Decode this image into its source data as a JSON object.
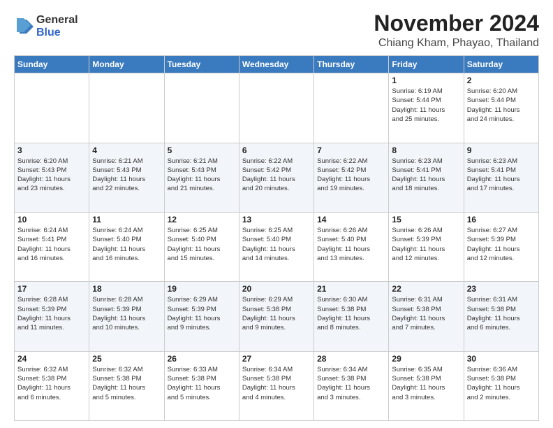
{
  "logo": {
    "general": "General",
    "blue": "Blue"
  },
  "title": "November 2024",
  "location": "Chiang Kham, Phayao, Thailand",
  "days_header": [
    "Sunday",
    "Monday",
    "Tuesday",
    "Wednesday",
    "Thursday",
    "Friday",
    "Saturday"
  ],
  "weeks": [
    [
      {
        "day": "",
        "info": ""
      },
      {
        "day": "",
        "info": ""
      },
      {
        "day": "",
        "info": ""
      },
      {
        "day": "",
        "info": ""
      },
      {
        "day": "",
        "info": ""
      },
      {
        "day": "1",
        "info": "Sunrise: 6:19 AM\nSunset: 5:44 PM\nDaylight: 11 hours\nand 25 minutes."
      },
      {
        "day": "2",
        "info": "Sunrise: 6:20 AM\nSunset: 5:44 PM\nDaylight: 11 hours\nand 24 minutes."
      }
    ],
    [
      {
        "day": "3",
        "info": "Sunrise: 6:20 AM\nSunset: 5:43 PM\nDaylight: 11 hours\nand 23 minutes."
      },
      {
        "day": "4",
        "info": "Sunrise: 6:21 AM\nSunset: 5:43 PM\nDaylight: 11 hours\nand 22 minutes."
      },
      {
        "day": "5",
        "info": "Sunrise: 6:21 AM\nSunset: 5:43 PM\nDaylight: 11 hours\nand 21 minutes."
      },
      {
        "day": "6",
        "info": "Sunrise: 6:22 AM\nSunset: 5:42 PM\nDaylight: 11 hours\nand 20 minutes."
      },
      {
        "day": "7",
        "info": "Sunrise: 6:22 AM\nSunset: 5:42 PM\nDaylight: 11 hours\nand 19 minutes."
      },
      {
        "day": "8",
        "info": "Sunrise: 6:23 AM\nSunset: 5:41 PM\nDaylight: 11 hours\nand 18 minutes."
      },
      {
        "day": "9",
        "info": "Sunrise: 6:23 AM\nSunset: 5:41 PM\nDaylight: 11 hours\nand 17 minutes."
      }
    ],
    [
      {
        "day": "10",
        "info": "Sunrise: 6:24 AM\nSunset: 5:41 PM\nDaylight: 11 hours\nand 16 minutes."
      },
      {
        "day": "11",
        "info": "Sunrise: 6:24 AM\nSunset: 5:40 PM\nDaylight: 11 hours\nand 16 minutes."
      },
      {
        "day": "12",
        "info": "Sunrise: 6:25 AM\nSunset: 5:40 PM\nDaylight: 11 hours\nand 15 minutes."
      },
      {
        "day": "13",
        "info": "Sunrise: 6:25 AM\nSunset: 5:40 PM\nDaylight: 11 hours\nand 14 minutes."
      },
      {
        "day": "14",
        "info": "Sunrise: 6:26 AM\nSunset: 5:40 PM\nDaylight: 11 hours\nand 13 minutes."
      },
      {
        "day": "15",
        "info": "Sunrise: 6:26 AM\nSunset: 5:39 PM\nDaylight: 11 hours\nand 12 minutes."
      },
      {
        "day": "16",
        "info": "Sunrise: 6:27 AM\nSunset: 5:39 PM\nDaylight: 11 hours\nand 12 minutes."
      }
    ],
    [
      {
        "day": "17",
        "info": "Sunrise: 6:28 AM\nSunset: 5:39 PM\nDaylight: 11 hours\nand 11 minutes."
      },
      {
        "day": "18",
        "info": "Sunrise: 6:28 AM\nSunset: 5:39 PM\nDaylight: 11 hours\nand 10 minutes."
      },
      {
        "day": "19",
        "info": "Sunrise: 6:29 AM\nSunset: 5:39 PM\nDaylight: 11 hours\nand 9 minutes."
      },
      {
        "day": "20",
        "info": "Sunrise: 6:29 AM\nSunset: 5:38 PM\nDaylight: 11 hours\nand 9 minutes."
      },
      {
        "day": "21",
        "info": "Sunrise: 6:30 AM\nSunset: 5:38 PM\nDaylight: 11 hours\nand 8 minutes."
      },
      {
        "day": "22",
        "info": "Sunrise: 6:31 AM\nSunset: 5:38 PM\nDaylight: 11 hours\nand 7 minutes."
      },
      {
        "day": "23",
        "info": "Sunrise: 6:31 AM\nSunset: 5:38 PM\nDaylight: 11 hours\nand 6 minutes."
      }
    ],
    [
      {
        "day": "24",
        "info": "Sunrise: 6:32 AM\nSunset: 5:38 PM\nDaylight: 11 hours\nand 6 minutes."
      },
      {
        "day": "25",
        "info": "Sunrise: 6:32 AM\nSunset: 5:38 PM\nDaylight: 11 hours\nand 5 minutes."
      },
      {
        "day": "26",
        "info": "Sunrise: 6:33 AM\nSunset: 5:38 PM\nDaylight: 11 hours\nand 5 minutes."
      },
      {
        "day": "27",
        "info": "Sunrise: 6:34 AM\nSunset: 5:38 PM\nDaylight: 11 hours\nand 4 minutes."
      },
      {
        "day": "28",
        "info": "Sunrise: 6:34 AM\nSunset: 5:38 PM\nDaylight: 11 hours\nand 3 minutes."
      },
      {
        "day": "29",
        "info": "Sunrise: 6:35 AM\nSunset: 5:38 PM\nDaylight: 11 hours\nand 3 minutes."
      },
      {
        "day": "30",
        "info": "Sunrise: 6:36 AM\nSunset: 5:38 PM\nDaylight: 11 hours\nand 2 minutes."
      }
    ]
  ]
}
